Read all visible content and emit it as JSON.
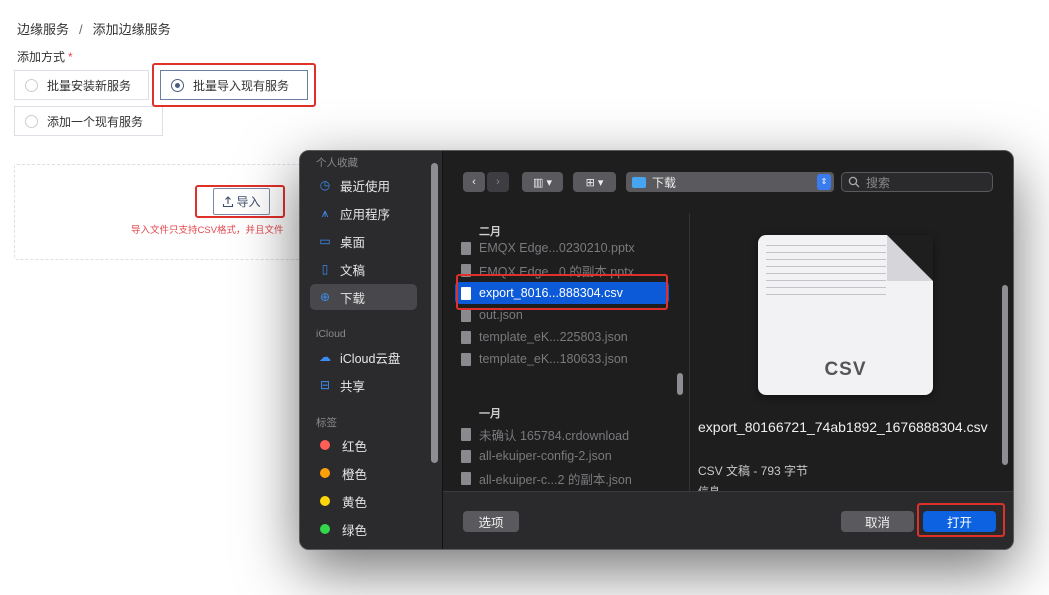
{
  "breadcrumb": {
    "parent": "边缘服务",
    "separator": "/",
    "current": "添加边缘服务"
  },
  "form": {
    "method_label": "添加方式",
    "required_mark": "*",
    "options": [
      {
        "label": "批量安装新服务",
        "checked": false
      },
      {
        "label": "批量导入现有服务",
        "checked": true
      },
      {
        "label": "添加一个现有服务",
        "checked": false
      }
    ]
  },
  "upload": {
    "import_button": "导入",
    "hint": "导入文件只支持CSV格式，并且文件"
  },
  "dialog": {
    "sidebar": {
      "sections": {
        "favorites": "个人收藏",
        "icloud": "iCloud",
        "tags": "标签"
      },
      "favorites": [
        {
          "label": "最近使用",
          "icon": "clock-icon"
        },
        {
          "label": "应用程序",
          "icon": "apps-icon"
        },
        {
          "label": "桌面",
          "icon": "desktop-icon"
        },
        {
          "label": "文稿",
          "icon": "document-icon"
        },
        {
          "label": "下载",
          "icon": "download-icon",
          "active": true
        }
      ],
      "icloud": [
        {
          "label": "iCloud云盘",
          "icon": "cloud-icon"
        },
        {
          "label": "共享",
          "icon": "shared-folder-icon"
        }
      ],
      "tags": [
        {
          "label": "红色",
          "color": "#ff5f57"
        },
        {
          "label": "橙色",
          "color": "#ff9f0a"
        },
        {
          "label": "黄色",
          "color": "#ffd60a"
        },
        {
          "label": "绿色",
          "color": "#32d74b"
        }
      ]
    },
    "toolbar": {
      "location": "下载",
      "search_placeholder": "搜索"
    },
    "files": {
      "group_feb": "二月",
      "feb_items": [
        "EMQX Edge...0230210.pptx",
        "EMQX Edge...0 的副本.pptx",
        "export_8016...888304.csv",
        "out.json",
        "template_eK...225803.json",
        "template_eK...180633.json"
      ],
      "group_jan": "一月",
      "jan_items": [
        "未确认 165784.crdownload",
        "all-ekuiper-config-2.json",
        "all-ekuiper-c...2 的副本.json"
      ]
    },
    "preview": {
      "doc_ext": "CSV",
      "filename": "export_80166721_74ab1892_1676888304.csv",
      "info": "CSV 文稿 - 793 字节",
      "more_label": "信息"
    },
    "footer": {
      "options_label": "选项",
      "cancel_label": "取消",
      "open_label": "打开"
    }
  }
}
